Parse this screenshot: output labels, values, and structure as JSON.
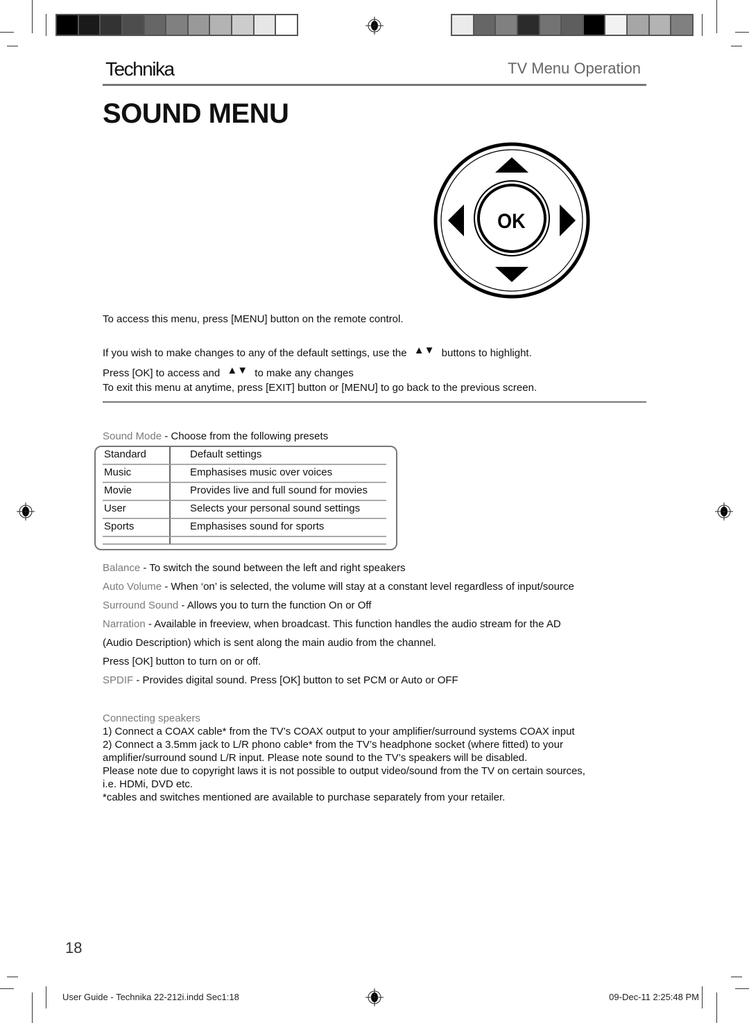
{
  "print_marks": {
    "left_swatches": [
      "#000000",
      "#1a1a1a",
      "#333333",
      "#4d4d4d",
      "#666666",
      "#808080",
      "#999999",
      "#b3b3b3",
      "#cccccc",
      "#e6e6e6",
      "#ffffff"
    ],
    "right_swatches": [
      "#ebebeb",
      "#666666",
      "#808080",
      "#2b2b2b",
      "#737373",
      "#5e5e5e",
      "#000000",
      "#f2f2f2",
      "#a6a6a6",
      "#b3b3b3",
      "#808080"
    ],
    "registration_icon": "crosshair-target"
  },
  "header": {
    "logo": "Technika",
    "section": "TV Menu Operation"
  },
  "title": "SOUND MENU",
  "remote": {
    "center_label": "OK",
    "icons": [
      "arrow-up",
      "arrow-down",
      "arrow-left",
      "arrow-right"
    ]
  },
  "intro": {
    "line1": "To access this menu, press [MENU] button on the remote control.",
    "line2a": "If you wish to make changes to any of the default settings, use the",
    "line2b": "buttons to highlight.",
    "line3a": "Press [OK] to access and",
    "line3b": "to make any changes",
    "line4": "To exit this menu at anytime, press [EXIT] button or [MENU] to go back to the previous screen."
  },
  "sound_mode": {
    "label": "Sound Mode",
    "desc": " - Choose from the following presets",
    "rows": [
      {
        "mode": "Standard",
        "desc": "Default settings"
      },
      {
        "mode": "Music",
        "desc": "Emphasises music over voices"
      },
      {
        "mode": "Movie",
        "desc": "Provides live and full sound for movies"
      },
      {
        "mode": "User",
        "desc": "Selects your personal sound settings"
      },
      {
        "mode": "Sports",
        "desc": "Emphasises sound for sports"
      }
    ]
  },
  "options": [
    {
      "label": "Balance",
      "desc": " - To switch the sound between the left and right speakers"
    },
    {
      "label": "Auto Volume",
      "desc": " - When ‘on’ is selected, the volume will stay at a constant level regardless of input/source"
    },
    {
      "label": "Surround Sound",
      "desc": " - Allows you to turn the function On or Off"
    },
    {
      "label": "Narration",
      "desc": " - Available in freeview, when broadcast. This function handles the audio stream for the AD"
    }
  ],
  "narration_cont1": "(Audio Description) which is sent along the main audio from the channel.",
  "narration_cont2": "Press [OK] button to turn on or off.",
  "spdif": {
    "label": "SPDIF",
    "desc": " - Provides digital sound. Press [OK] button to set PCM or Auto or OFF"
  },
  "connecting": {
    "heading": "Connecting speakers",
    "lines": [
      "1) Connect a COAX cable* from the TV’s COAX output to your amplifier/surround systems COAX input",
      "2) Connect a 3.5mm jack to L/R phono cable* from the TV’s headphone socket (where fitted) to your",
      "amplifier/surround sound L/R input. Please note sound to the TV’s speakers will be disabled.",
      "Please note due to copyright laws it is not possible to output video/sound from the TV on certain sources,",
      "i.e. HDMi, DVD etc.",
      "*cables and switches mentioned are available to purchase separately from your retailer."
    ]
  },
  "page_number": "18",
  "footer": {
    "left": "User Guide - Technika 22-212i.indd   Sec1:18",
    "right": "09-Dec-11   2:25:48 PM"
  }
}
